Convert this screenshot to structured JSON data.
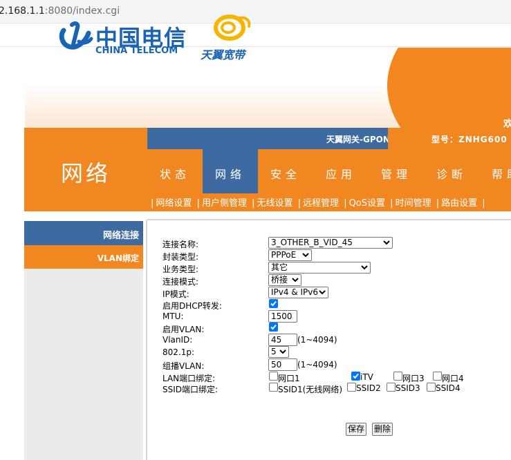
{
  "browser": {
    "url_host": "2.168.1.1",
    "url_rest": ":8080/index.cgi"
  },
  "banner": {
    "brand_cn": "中国电信",
    "brand_en": "CHINA TELECOM",
    "sub_brand": "天翼宽带",
    "welcome": "欢"
  },
  "header": {
    "section_title": "网络",
    "gateway_name": "天翼网关-GPON",
    "model_label": "型号：ZNHG600"
  },
  "tabs": [
    {
      "label": "状态",
      "active": false
    },
    {
      "label": "网络",
      "active": true
    },
    {
      "label": "安全",
      "active": false
    },
    {
      "label": "应用",
      "active": false
    },
    {
      "label": "管理",
      "active": false
    },
    {
      "label": "诊断",
      "active": false
    },
    {
      "label": "帮助",
      "active": false
    }
  ],
  "subnav": [
    "网络设置",
    "用户侧管理",
    "无线设置",
    "远程管理",
    "QoS设置",
    "时间管理",
    "路由设置"
  ],
  "sidebar": {
    "items": [
      {
        "label": "网络连接",
        "active": true
      },
      {
        "label": "VLAN绑定",
        "active": false
      }
    ]
  },
  "form": {
    "conn_name_label": "连接名称:",
    "conn_name_value": "3_OTHER_B_VID_45",
    "encap_label": "封装类型:",
    "encap_value": "PPPoE",
    "service_label": "业务类型:",
    "service_value": "其它",
    "mode_label": "连接模式:",
    "mode_value": "桥接",
    "ip_mode_label": "IP模式:",
    "ip_mode_value": "IPv4 & IPv6",
    "dhcp_relay_label": "启用DHCP转发:",
    "dhcp_relay_checked": true,
    "mtu_label": "MTU:",
    "mtu_value": "1500",
    "vlan_enable_label": "启用VLAN:",
    "vlan_enable_checked": true,
    "vlanid_label": "VlanID:",
    "vlanid_value": "45",
    "vlanid_hint": "(1~4094)",
    "dot1p_label": "802.1p:",
    "dot1p_value": "5",
    "mcast_vlan_label": "组播VLAN:",
    "mcast_vlan_value": "50",
    "mcast_vlan_hint": "(1~4094)",
    "lan_bind_label": "LAN端口绑定:",
    "lan_ports": [
      {
        "label": "网口1",
        "checked": false
      },
      {
        "label": "iTV",
        "checked": true
      },
      {
        "label": "网口3",
        "checked": false
      },
      {
        "label": "网口4",
        "checked": false
      }
    ],
    "ssid_bind_label": "SSID端口绑定:",
    "ssids": [
      {
        "label": "SSID1(无线网络)",
        "checked": false
      },
      {
        "label": "SSID2",
        "checked": false
      },
      {
        "label": "SSID3",
        "checked": false
      },
      {
        "label": "SSID4",
        "checked": false
      }
    ]
  },
  "buttons": {
    "save": "保存",
    "delete": "删除"
  },
  "colors": {
    "orange": "#f08721",
    "blue": "#3d6aa0",
    "brand_blue": "#1b63b5",
    "check_blue": "#0075ff"
  }
}
